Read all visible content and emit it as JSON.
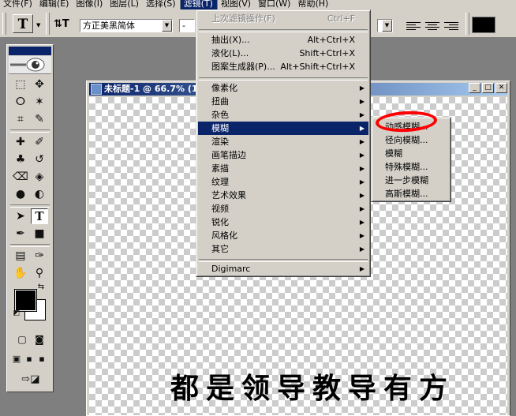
{
  "menubar": {
    "items": [
      "文件(F)",
      "编辑(E)",
      "图像(I)",
      "图层(L)",
      "选择(S)",
      "滤镜(T)",
      "视图(V)",
      "窗口(W)",
      "帮助(H)"
    ],
    "active_index": 5
  },
  "options": {
    "tool_glyph": "T",
    "orient_glyph": "⇅T",
    "font_family": "方正美黑简体",
    "font_style": "-",
    "size_suffix": ""
  },
  "document": {
    "title": "未标题-1 @ 66.7% (1",
    "text": "都是领导教导有方"
  },
  "filter_menu": {
    "items": [
      {
        "label": "上次滤镜操作(F)",
        "shortcut": "Ctrl+F",
        "disabled": true
      },
      {
        "label": "抽出(X)...",
        "shortcut": "Alt+Ctrl+X"
      },
      {
        "label": "液化(L)...",
        "shortcut": "Shift+Ctrl+X"
      },
      {
        "label": "图案生成器(P)...",
        "shortcut": "Alt+Shift+Ctrl+X"
      },
      {
        "label": "像素化"
      },
      {
        "label": "扭曲"
      },
      {
        "label": "杂色"
      },
      {
        "label": "模糊"
      },
      {
        "label": "渲染"
      },
      {
        "label": "画笔描边"
      },
      {
        "label": "素描"
      },
      {
        "label": "纹理"
      },
      {
        "label": "艺术效果"
      },
      {
        "label": "视频"
      },
      {
        "label": "锐化"
      },
      {
        "label": "风格化"
      },
      {
        "label": "其它"
      },
      {
        "label": "Digimarc"
      }
    ]
  },
  "blur_submenu": {
    "items": [
      "动感模糊...",
      "径向模糊...",
      "模糊",
      "特殊模糊...",
      "进一步模糊",
      "高斯模糊..."
    ]
  },
  "colors": {
    "highlight": "#0a246a",
    "annotation": "#ff0000"
  }
}
